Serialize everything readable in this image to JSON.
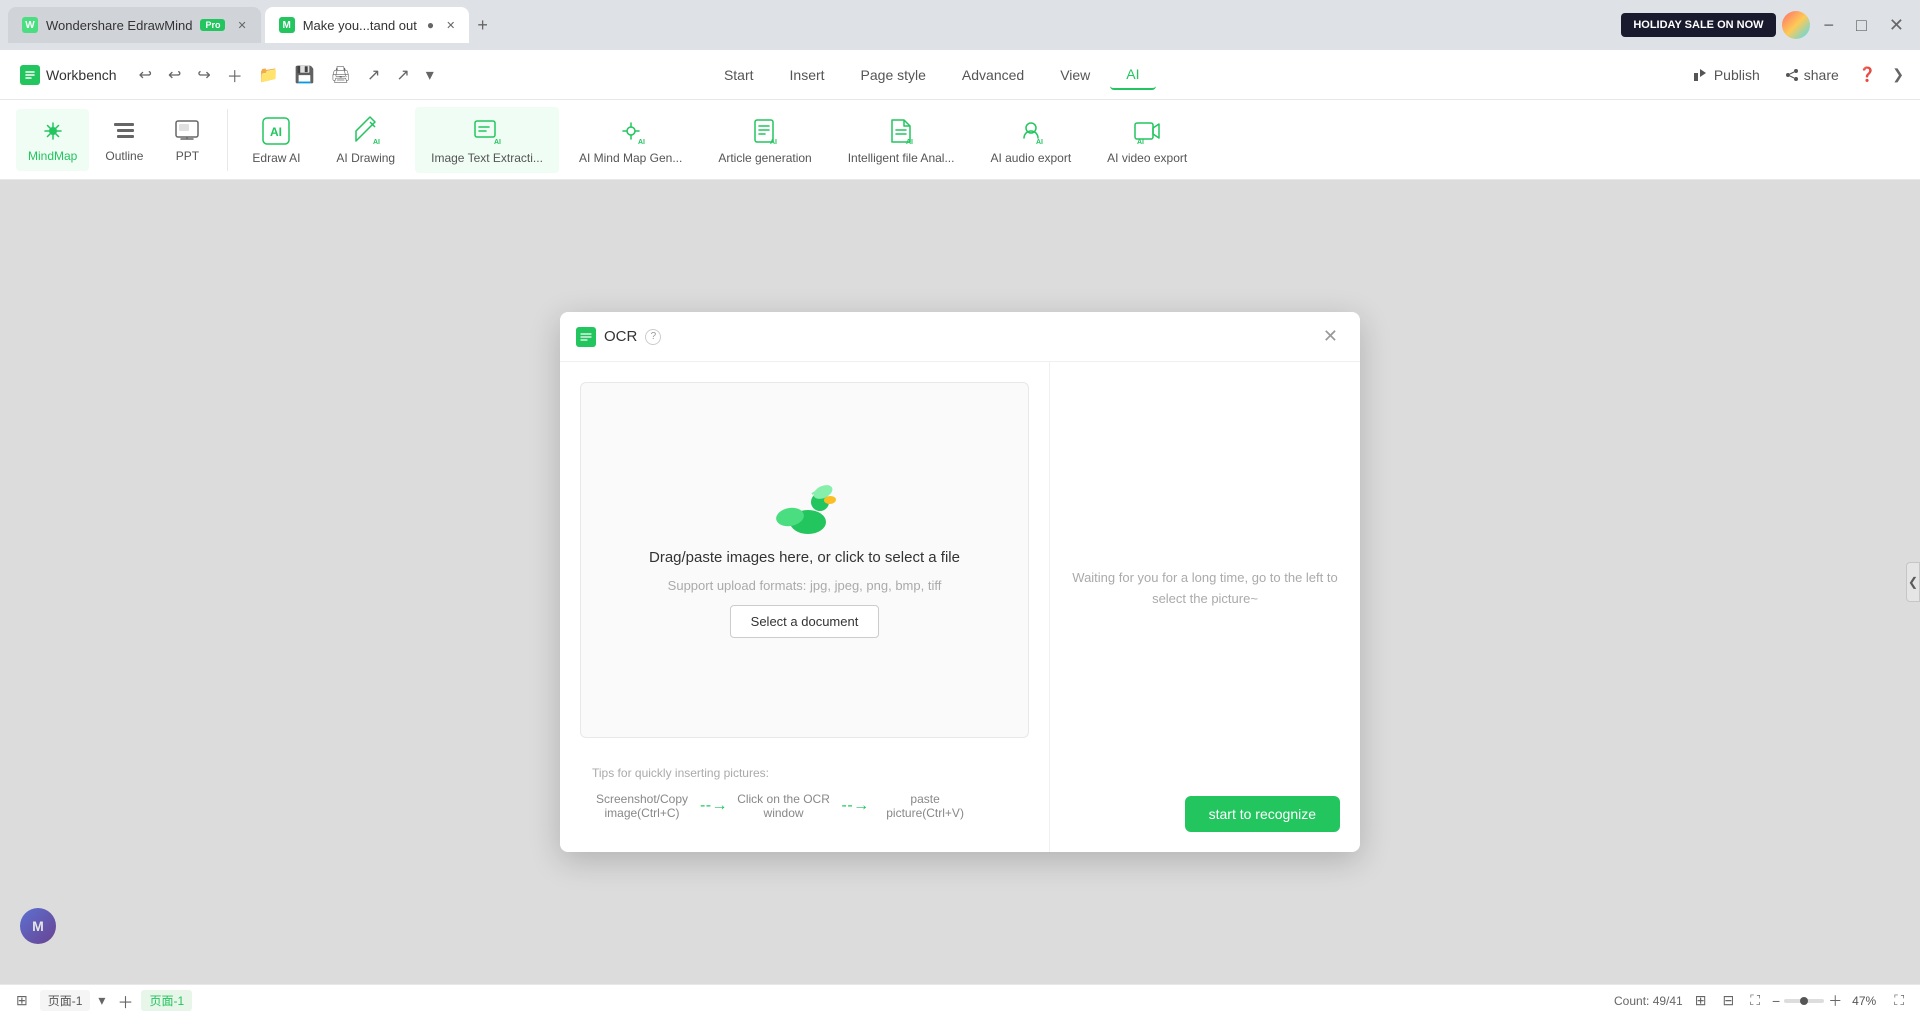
{
  "browser": {
    "tabs": [
      {
        "id": "tab-wondershare",
        "title": "Wondershare EdrawMind",
        "badge": "Pro",
        "active": false,
        "icon": "W"
      },
      {
        "id": "tab-make",
        "title": "Make you...tand out",
        "active": true,
        "modified": true,
        "icon": "M"
      }
    ],
    "new_tab_label": "+",
    "controls": {
      "minimize": "−",
      "maximize": "□",
      "close": "✕"
    },
    "holiday_banner": "HOLIDAY SALE ON NOW"
  },
  "titlebar": {
    "workbench_label": "Workbench",
    "undo": "↩",
    "redo": "↪",
    "save": "💾",
    "nav": [
      "Start",
      "Insert",
      "Page style",
      "Advanced",
      "View",
      "AI"
    ],
    "active_nav": "AI",
    "publish_label": "Publish",
    "share_label": "share"
  },
  "toolbar": {
    "view_buttons": [
      {
        "id": "mindmap",
        "label": "MindMap"
      },
      {
        "id": "outline",
        "label": "Outline"
      },
      {
        "id": "ppt",
        "label": "PPT"
      }
    ],
    "active_view": "mindmap",
    "ai_buttons": [
      {
        "id": "edraw-ai",
        "label": "Edraw AI"
      },
      {
        "id": "ai-drawing",
        "label": "AI Drawing"
      },
      {
        "id": "image-text-extract",
        "label": "Image Text Extracti..."
      },
      {
        "id": "ai-mindmap-gen",
        "label": "AI Mind Map Gen..."
      },
      {
        "id": "article-gen",
        "label": "Article generation"
      },
      {
        "id": "intelligent-file-anal",
        "label": "Intelligent file Anal..."
      },
      {
        "id": "ai-audio-export",
        "label": "AI audio export"
      },
      {
        "id": "ai-video-export",
        "label": "AI video export"
      }
    ],
    "active_ai": "image-text-extract"
  },
  "ocr_dialog": {
    "title": "OCR",
    "upload": {
      "main_text": "Drag/paste images here, or click to select a file",
      "sub_text": "Support upload formats: jpg, jpeg, png, bmp, tiff",
      "select_btn_label": "Select a document"
    },
    "tips": {
      "title": "Tips for quickly inserting pictures:",
      "step1": "Screenshot/Copy image(Ctrl+C)",
      "step2": "Click on the OCR window",
      "step3": "paste picture(Ctrl+V)"
    },
    "waiting_text": "Waiting for you for a long time, go to the left to select the picture~",
    "start_btn_label": "start to recognize"
  },
  "status_bar": {
    "page_label_left": "页面-1",
    "page_label_active": "页面-1",
    "count_label": "Count: 49/41",
    "zoom_level": "47%"
  }
}
